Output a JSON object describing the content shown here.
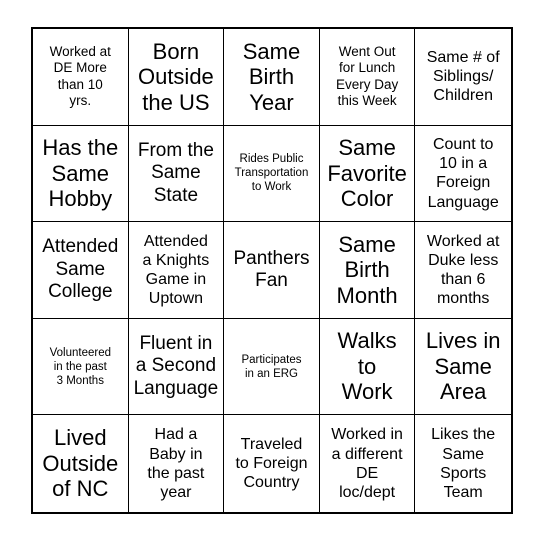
{
  "card": {
    "type": "bingo-card",
    "columns": 5,
    "rows": 5,
    "border_color": "#000000",
    "background_color": "#ffffff",
    "text_color": "#000000",
    "cells": [
      {
        "text": "Worked at\nDE More\nthan 10\nyrs.",
        "size": "s"
      },
      {
        "text": "Born\nOutside\nthe US",
        "size": "xl"
      },
      {
        "text": "Same\nBirth\nYear",
        "size": "xl"
      },
      {
        "text": "Went Out\nfor Lunch\nEvery Day\nthis Week",
        "size": "s"
      },
      {
        "text": "Same # of\nSiblings/\nChildren",
        "size": "m"
      },
      {
        "text": "Has the\nSame\nHobby",
        "size": "xl"
      },
      {
        "text": "From the\nSame\nState",
        "size": "l"
      },
      {
        "text": "Rides Public\nTransportation\nto Work",
        "size": "xs"
      },
      {
        "text": "Same\nFavorite\nColor",
        "size": "xl"
      },
      {
        "text": "Count to\n10 in a\nForeign\nLanguage",
        "size": "m"
      },
      {
        "text": "Attended\nSame\nCollege",
        "size": "l"
      },
      {
        "text": "Attended\na Knights\nGame in\nUptown",
        "size": "m"
      },
      {
        "text": "Panthers\nFan",
        "size": "l"
      },
      {
        "text": "Same\nBirth\nMonth",
        "size": "xl"
      },
      {
        "text": "Worked at\nDuke less\nthan 6\nmonths",
        "size": "m"
      },
      {
        "text": "Volunteered\nin the past\n3 Months",
        "size": "xs"
      },
      {
        "text": "Fluent in\na Second\nLanguage",
        "size": "l"
      },
      {
        "text": "Participates\nin an ERG",
        "size": "xs"
      },
      {
        "text": "Walks\nto\nWork",
        "size": "xl"
      },
      {
        "text": "Lives in\nSame\nArea",
        "size": "xl"
      },
      {
        "text": "Lived\nOutside\nof NC",
        "size": "xl"
      },
      {
        "text": "Had a\nBaby in\nthe past\nyear",
        "size": "m"
      },
      {
        "text": "Traveled\nto Foreign\nCountry",
        "size": "m"
      },
      {
        "text": "Worked in\na different\nDE\nloc/dept",
        "size": "m"
      },
      {
        "text": "Likes the\nSame\nSports\nTeam",
        "size": "m"
      }
    ]
  }
}
